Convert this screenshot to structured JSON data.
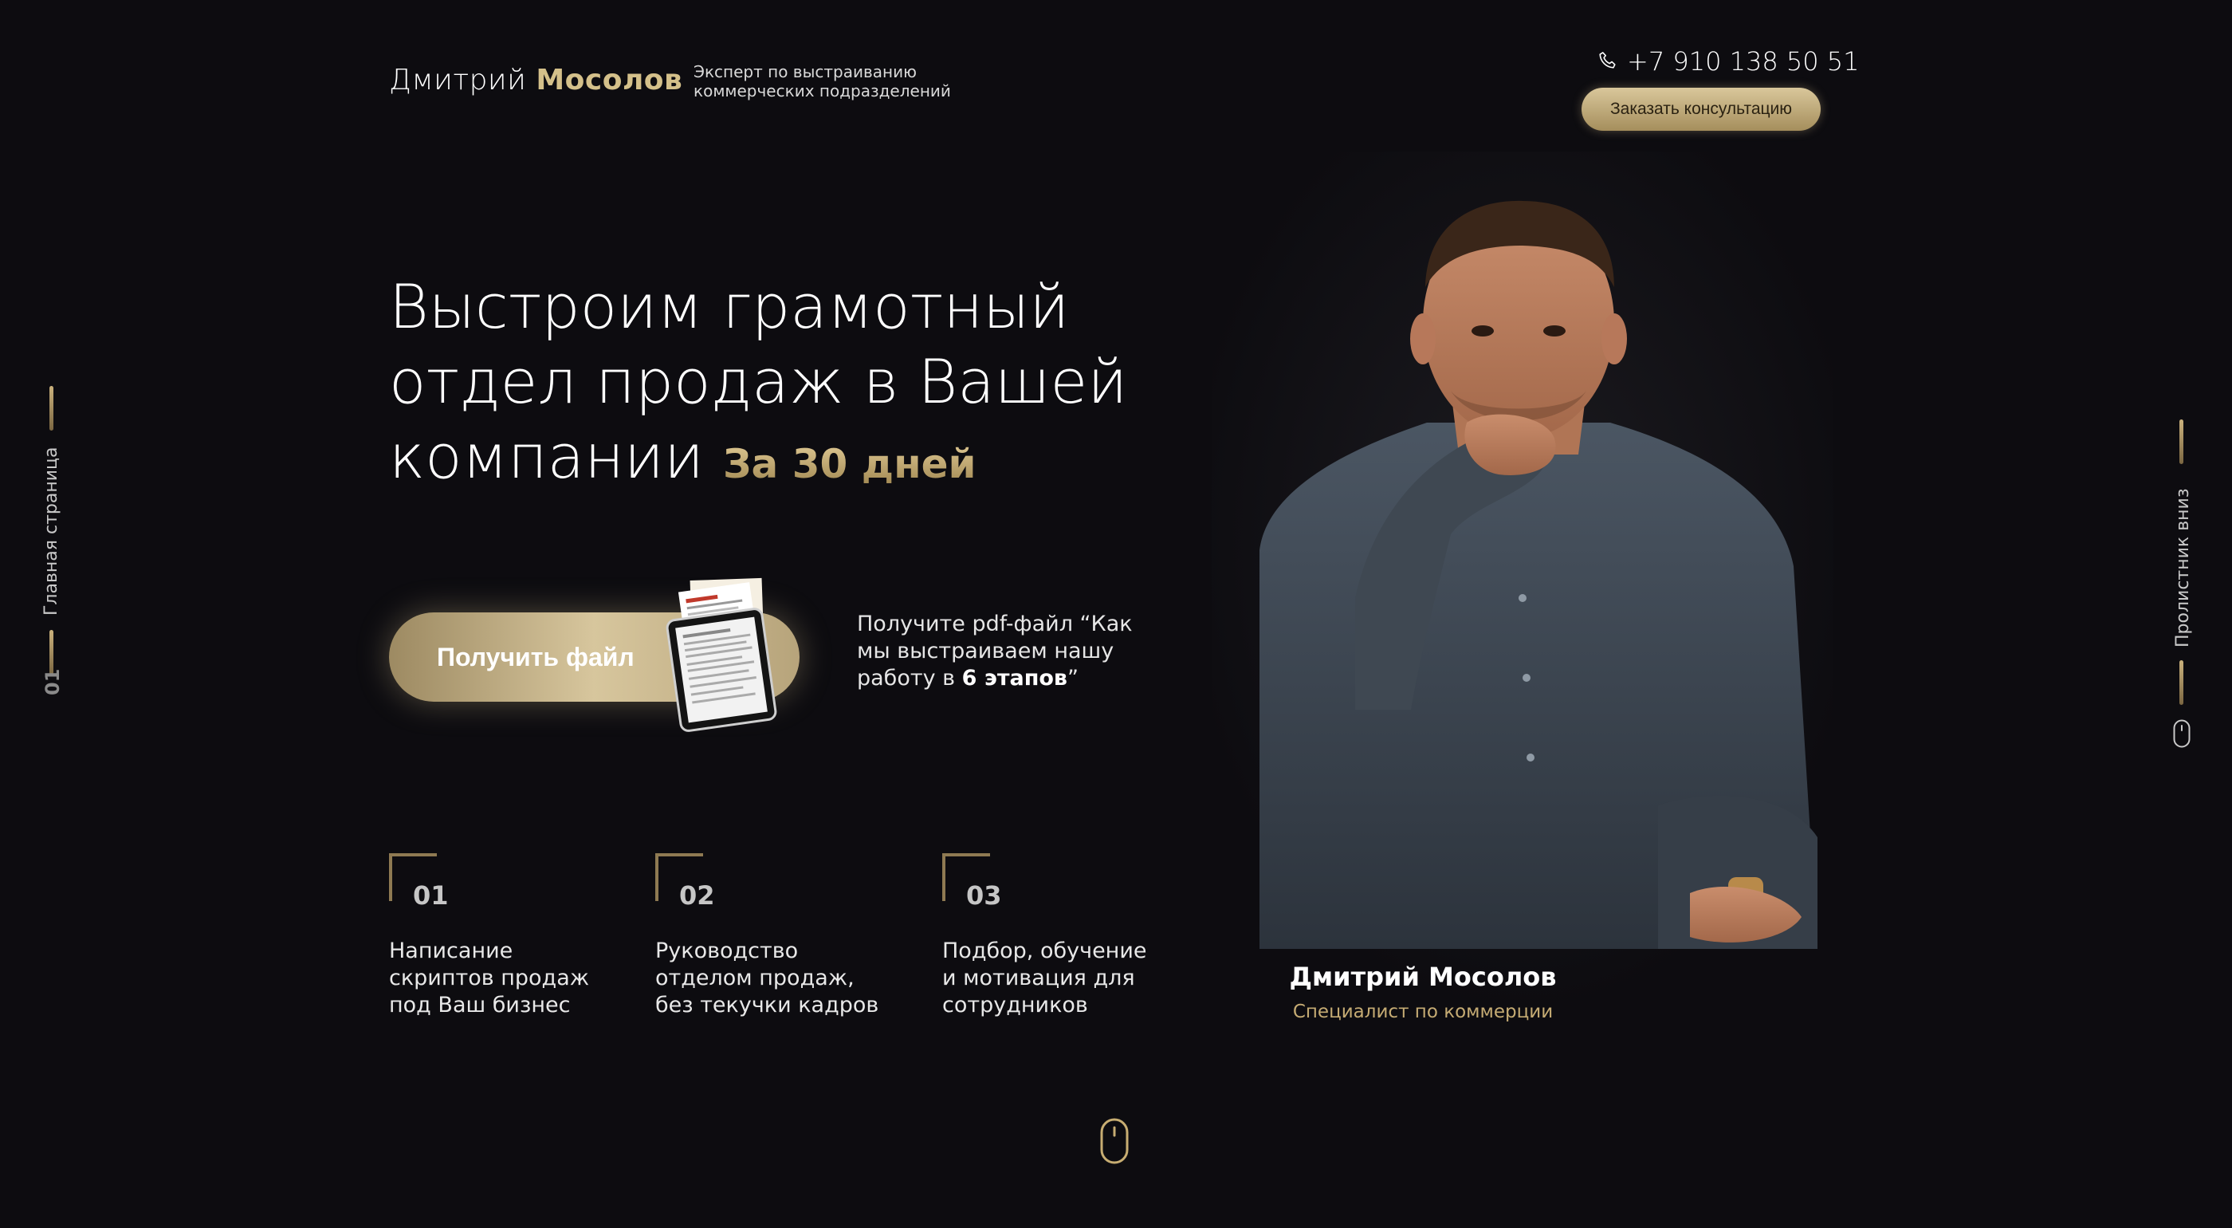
{
  "header": {
    "brand_first": "Дмитрий",
    "brand_last": "Мосолов",
    "tagline_line1": "Эксперт по выстраиванию",
    "tagline_line2": "коммерческих подразделений",
    "phone": "+7 910 138 50 51",
    "phone_icon": "phone-icon",
    "consult_button": "Заказать консультацию"
  },
  "side_nav": {
    "left_label": "Главная страница",
    "left_number": "01",
    "right_label": "Пролистник вниз",
    "right_icon": "mouse-icon"
  },
  "hero": {
    "title_line1": "Выстроим грамотный",
    "title_line2": "отдел продаж в Вашей",
    "title_line3": "компании",
    "title_accent": "За 30 дней",
    "get_file_button": "Получить файл",
    "file_note_text": "Получите pdf-файл “Как мы выстраиваем нашу работу в",
    "file_note_bold": "6 этапов",
    "file_note_end": "”"
  },
  "steps": [
    {
      "number": "01",
      "line1": "Написание",
      "line2": "скриптов продаж",
      "line3": "под Ваш бизнес"
    },
    {
      "number": "02",
      "line1": "Руководство",
      "line2": "отделом продаж,",
      "line3": "без текучки кадров"
    },
    {
      "number": "03",
      "line1": "Подбор, обучение",
      "line2": "и мотивация для",
      "line3": "сотрудников"
    }
  ],
  "person": {
    "name": "Дмитрий Мосолов",
    "role": "Специалист по коммерции"
  },
  "colors": {
    "background": "#0d0c10",
    "gold": "#cdb88a",
    "gold_dark": "#8e7a52"
  }
}
